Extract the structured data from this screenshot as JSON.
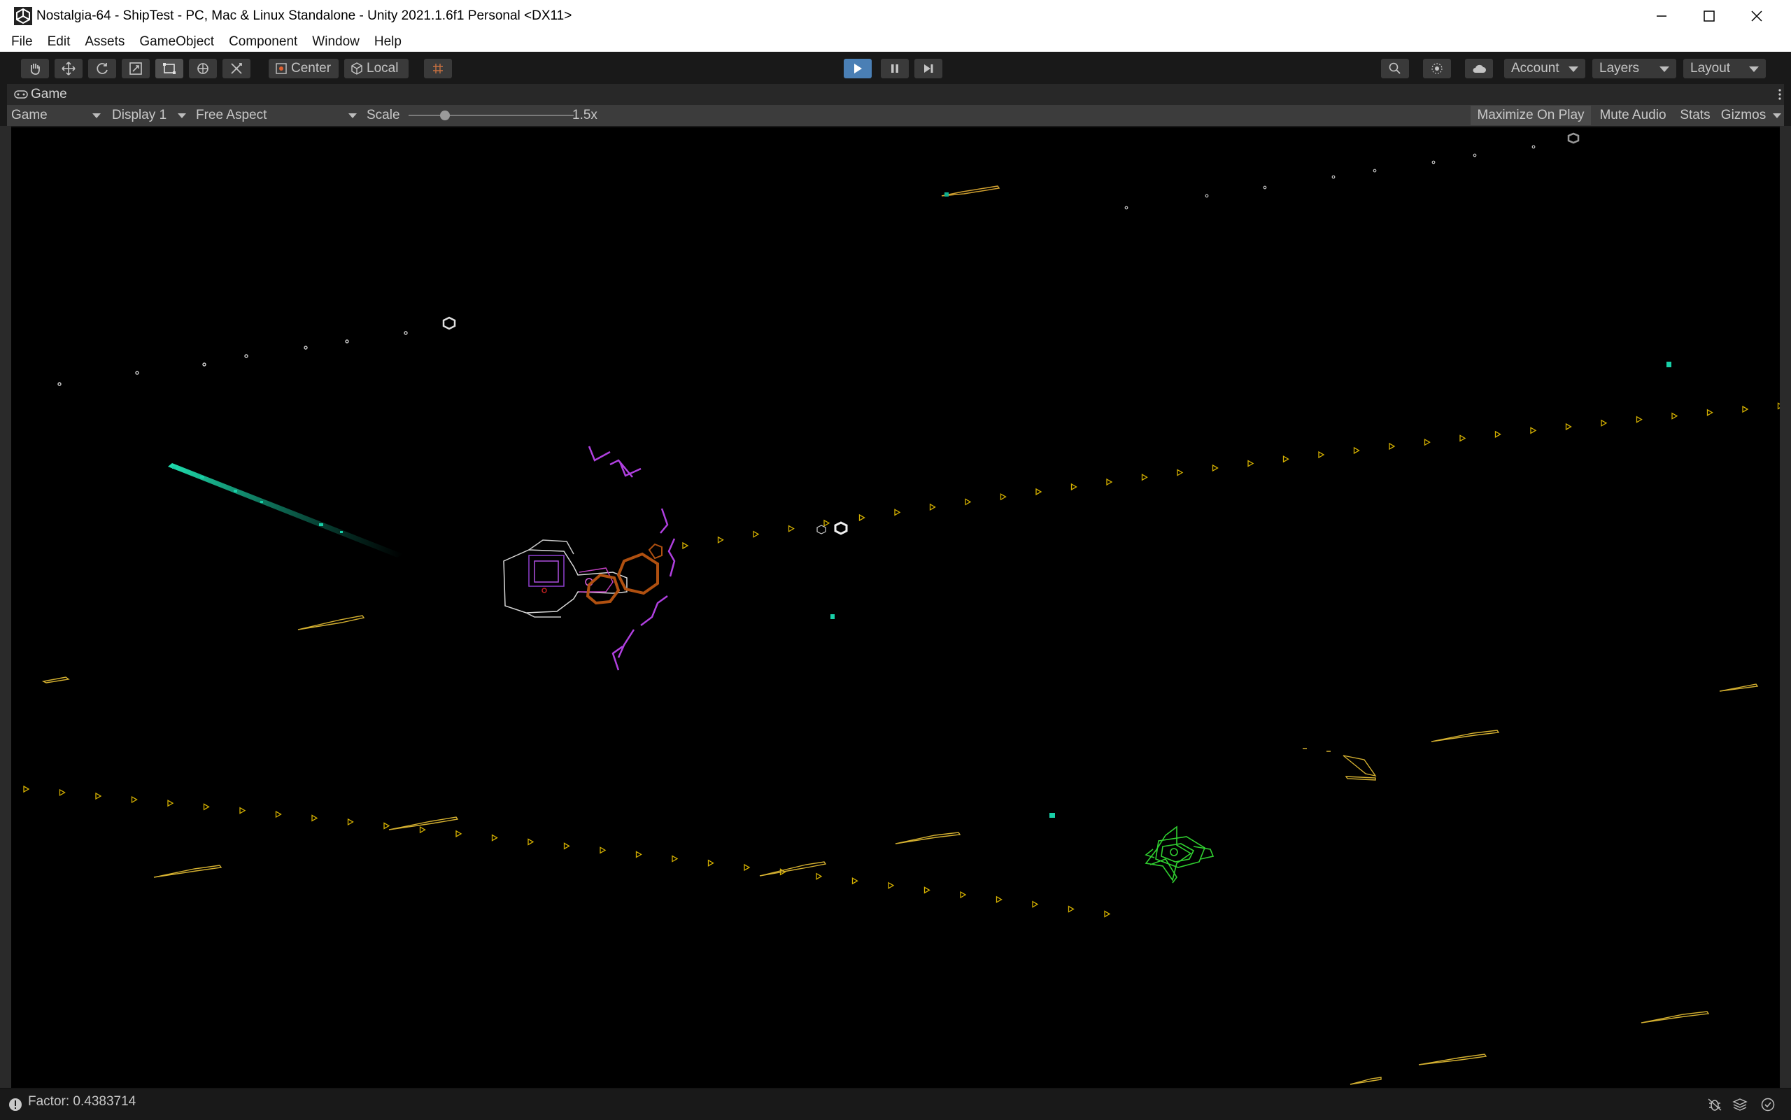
{
  "window": {
    "title": "Nostalgia-64 - ShipTest - PC, Mac & Linux Standalone - Unity 2021.1.6f1 Personal <DX11>"
  },
  "menubar": {
    "items": [
      "File",
      "Edit",
      "Assets",
      "GameObject",
      "Component",
      "Window",
      "Help"
    ]
  },
  "toolbar": {
    "tools": [
      "hand-tool-icon",
      "move-tool-icon",
      "rotate-tool-icon",
      "scale-tool-icon",
      "rect-tool-icon",
      "transform-tool-icon",
      "custom-tool-icon"
    ],
    "pivot_label": "Center",
    "space_label": "Local",
    "account_label": "Account",
    "layers_label": "Layers",
    "layout_label": "Layout"
  },
  "game_tab": {
    "tab_label": "Game",
    "view_select": "Game",
    "display_select": "Display 1",
    "aspect_select": "Free Aspect",
    "scale_label": "Scale",
    "scale_value": "1.5x",
    "scale_slider_level": 0.22,
    "toggles": [
      "Maximize On Play",
      "Mute Audio",
      "Stats",
      "Gizmos"
    ]
  },
  "status": {
    "message": "Factor: 0.4383714"
  },
  "colors": {
    "accent_play": "#4a7fb5",
    "editor_bg": "#191919",
    "viewport_bg": "#000000",
    "bullet_yellow": "#d4b000",
    "player_purple": "#b040e0",
    "enemy_green": "#30d030",
    "engine_orange": "#c05a10",
    "trail_cyan": "#18c0a0"
  }
}
